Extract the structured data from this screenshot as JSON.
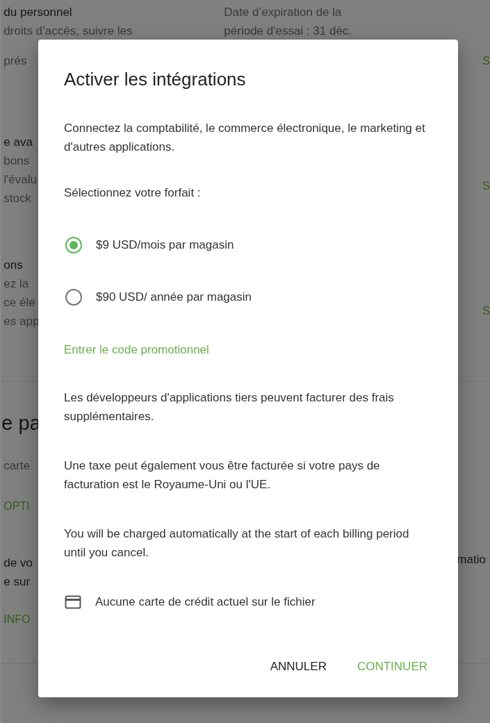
{
  "background": {
    "left_fragments": [
      {
        "text": "du personnel",
        "kind": "heading"
      },
      {
        "text": "droits d’accès, suivre les",
        "kind": "body"
      },
      {
        "text": "prés",
        "kind": "body"
      },
      {
        "text": "e ava",
        "kind": "heading"
      },
      {
        "text": "bons",
        "kind": "body"
      },
      {
        "text": "l'évalu",
        "kind": "body"
      },
      {
        "text": "stock",
        "kind": "body"
      },
      {
        "text": "ons",
        "kind": "heading"
      },
      {
        "text": "ez la",
        "kind": "body"
      },
      {
        "text": "ce éle",
        "kind": "body"
      },
      {
        "text": "es app",
        "kind": "body"
      },
      {
        "text": "e pa",
        "kind": "title"
      },
      {
        "text": "carte",
        "kind": "body"
      },
      {
        "text": "OPTI",
        "kind": "link"
      },
      {
        "text": "de vo",
        "kind": "heading"
      },
      {
        "text": "e sur",
        "kind": "heading"
      },
      {
        "text": "INFO",
        "kind": "link"
      }
    ],
    "trial_lines": [
      "Date d’expiration de la",
      "période d'essai : 31 déc."
    ],
    "right_fragments": [
      "S",
      "S",
      "S"
    ],
    "right_text": "matio"
  },
  "dialog": {
    "title": "Activer les intégrations",
    "intro": "Connectez la comptabilité, le commerce électronique, le marketing et d'autres applications.",
    "plan_prompt": "Sélectionnez votre forfait :",
    "plans": [
      {
        "label": "$9 USD/mois par magasin",
        "selected": true
      },
      {
        "label": "$90 USD/ année par magasin",
        "selected": false
      }
    ],
    "promo_link": "Entrer le code promotionnel",
    "notes": [
      "Les développeurs d'applications tiers peuvent facturer des frais supplémentaires.",
      "Une taxe peut également vous être facturée si votre pays de facturation est le Royaume-Uni ou l'UE.",
      "You will be charged automatically at the start of each billing period until you cancel."
    ],
    "card_status": "Aucune carte de crédit actuel sur le fichier",
    "buttons": [
      {
        "label": "ANNULER",
        "kind": "secondary"
      },
      {
        "label": "CONTINUER",
        "kind": "primary"
      }
    ]
  }
}
